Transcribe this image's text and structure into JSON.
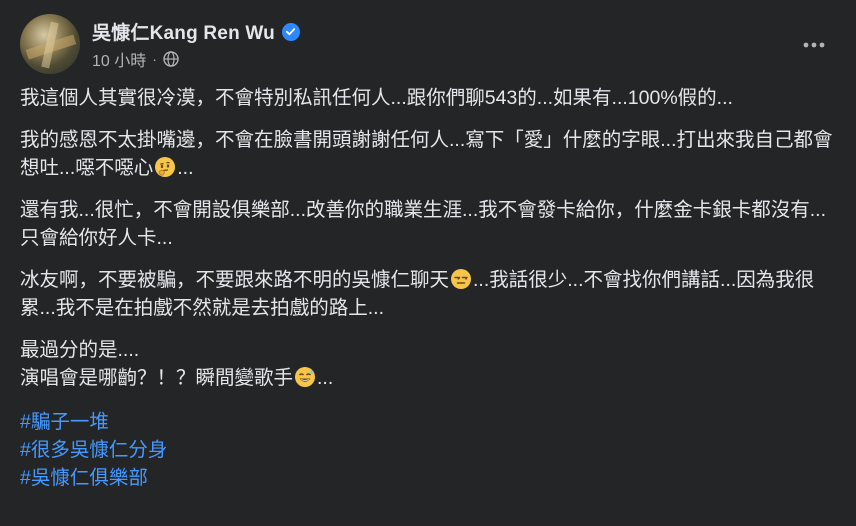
{
  "post": {
    "author": "吳慷仁Kang Ren Wu",
    "timestamp": "10 小時",
    "separator": "·",
    "paragraphs": [
      {
        "text": "我這個人其實很冷漠，不會特別私訊任何人...跟你們聊543的...如果有...100%假的..."
      },
      {
        "before": "我的感恩不太掛嘴邊，不會在臉書開頭謝謝任何人...寫下「愛」什麼的字眼...打出來我自己都會想吐...噁不噁心",
        "emoji": "thinking-face-icon",
        "after": "..."
      },
      {
        "text": "還有我...很忙，不會開設俱樂部...改善你的職業生涯...我不會發卡給你，什麼金卡銀卡都沒有...只會給你好人卡..."
      },
      {
        "before": "冰友啊，不要被騙，不要跟來路不明的吳慷仁聊天",
        "emoji": "unamused-face-icon",
        "after": "...我話很少...不會找你們講話...因為我很累...我不是在拍戲不然就是去拍戲的路上..."
      },
      {
        "line1": "最過分的是....",
        "before": "演唱會是哪齣？！？瞬間變歌手",
        "emoji": "grinning-sweat-face-icon",
        "after": "..."
      }
    ],
    "hashtags": [
      "#騙子一堆",
      "#很多吳慷仁分身",
      "#吳慷仁俱樂部"
    ]
  },
  "colors": {
    "background": "#242526",
    "text": "#e4e6eb",
    "secondary_text": "#b0b3b8",
    "link": "#4599ff",
    "verified": "#2d88ff"
  },
  "icons": {
    "verified": "verified-badge-icon",
    "audience": "globe-icon",
    "menu": "more-options-icon"
  }
}
